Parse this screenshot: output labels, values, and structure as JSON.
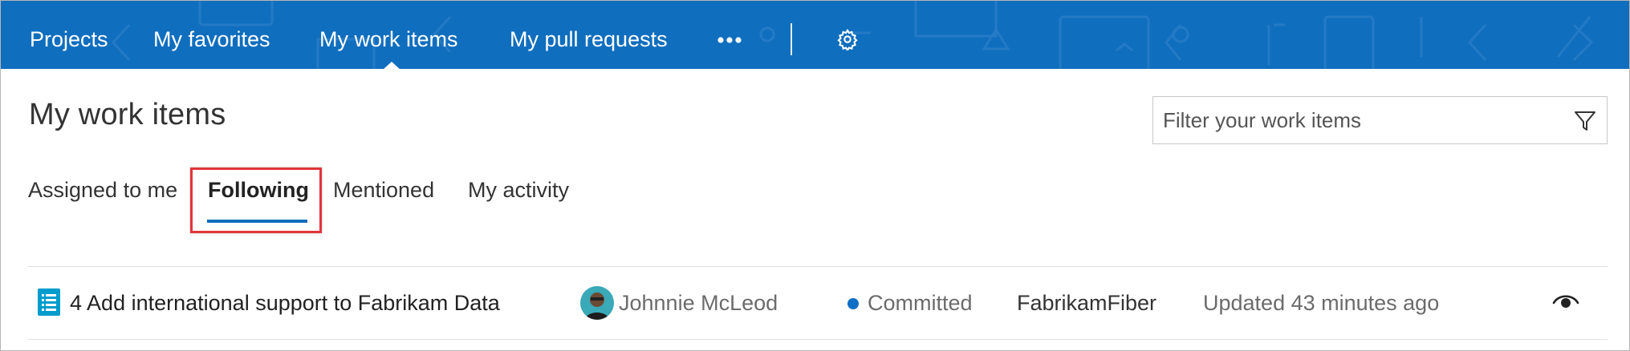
{
  "nav": {
    "items": [
      "Projects",
      "My favorites",
      "My work items",
      "My pull requests"
    ],
    "more_icon": "ellipsis-icon",
    "settings_icon": "gear-icon",
    "bg_color": "#106ebe"
  },
  "page": {
    "title": "My work items"
  },
  "filter": {
    "placeholder": "Filter your work items",
    "icon": "funnel-icon"
  },
  "tabs": [
    {
      "label": "Assigned to me",
      "selected": false
    },
    {
      "label": "Following",
      "selected": true
    },
    {
      "label": "Mentioned",
      "selected": false
    },
    {
      "label": "My activity",
      "selected": false
    }
  ],
  "work_items": [
    {
      "id": "4",
      "title": "Add international support to Fabrikam Data",
      "type_icon": "backlog-item-icon",
      "assigned_to": "Johnnie McLeod",
      "state": "Committed",
      "state_color": "#0f6fc5",
      "project": "FabrikamFiber",
      "updated": "Updated 43 minutes ago",
      "follow_icon": "eye-icon"
    }
  ],
  "colors": {
    "accent": "#106ebe",
    "highlight": "#e2343b"
  }
}
